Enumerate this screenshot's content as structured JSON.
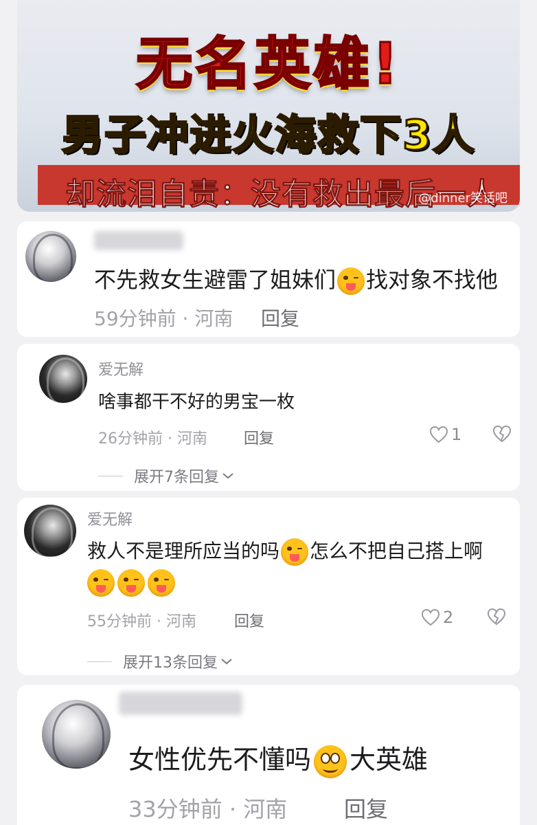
{
  "banner": {
    "title": "无名英雄!",
    "subtitle": "男子冲进火海救下3人",
    "strip": "却流泪自责：没有救出最后一人",
    "watermark": "@dinner笑话吧"
  },
  "comments": [
    {
      "username": "",
      "text_before": "不先救女生避雷了姐妹们",
      "text_after": "找对象不找他",
      "emoji": "squint-tongue-emoji",
      "time": "59分钟前",
      "location": "河南",
      "reply_label": "回复"
    },
    {
      "username": "爱无解",
      "text": "啥事都干不好的男宝一枚",
      "time": "26分钟前",
      "location": "河南",
      "reply_label": "回复",
      "likes": "1",
      "expand_label": "展开7条回复"
    },
    {
      "username": "爱无解",
      "text_before": "救人不是理所应当的吗",
      "text_after": "怎么不把自己搭上啊",
      "emoji": "squint-tongue-emoji",
      "time": "55分钟前",
      "location": "河南",
      "reply_label": "回复",
      "likes": "2",
      "expand_label": "展开13条回复"
    },
    {
      "username": "",
      "text_before": "女性优先不懂吗",
      "text_after": "大英雄",
      "emoji": "smile-emoji",
      "time": "33分钟前",
      "location": "河南",
      "reply_label": "回复"
    }
  ],
  "separator": " · "
}
